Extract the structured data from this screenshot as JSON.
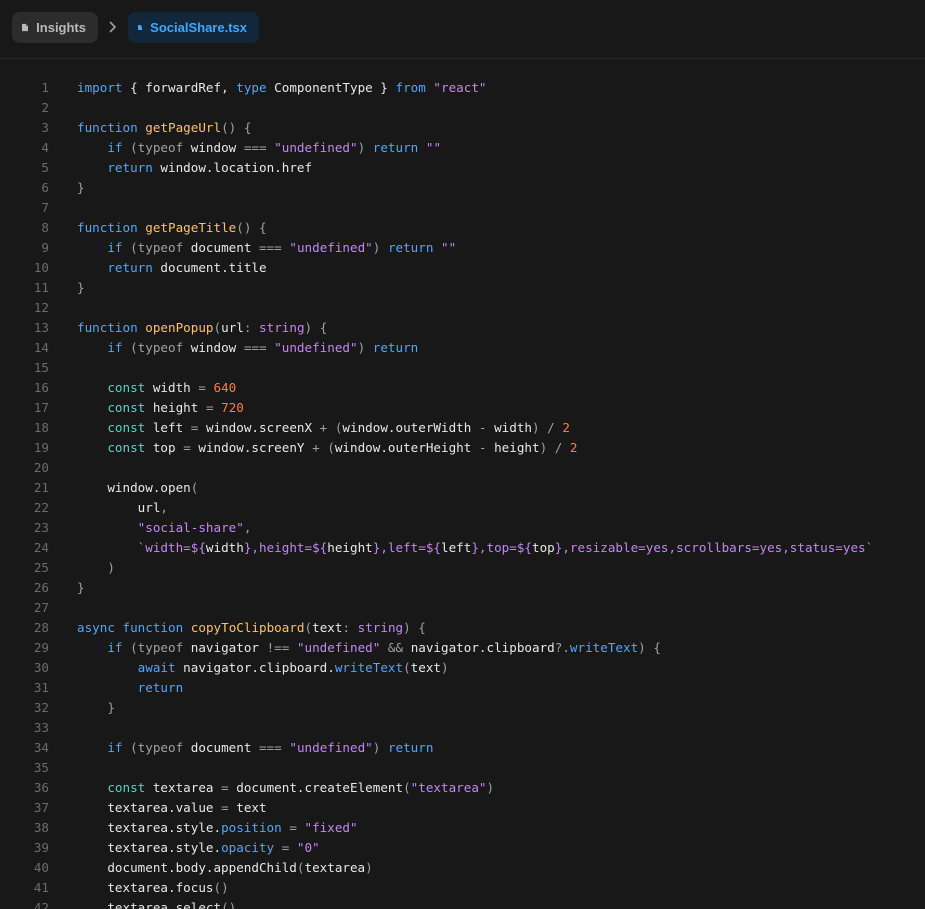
{
  "breadcrumb": {
    "items": [
      {
        "label": "Insights",
        "icon": "file-icon"
      },
      {
        "label": "SocialShare.tsx",
        "icon": "file-icon"
      }
    ]
  },
  "colors": {
    "background": "#181818",
    "keyword": "#4fa6ff",
    "function": "#ffc266",
    "string": "#c585f5",
    "number": "#ff7a45",
    "accent": "#3ea8ff"
  },
  "code": {
    "lines": [
      [
        [
          "kw",
          "import"
        ],
        [
          "p",
          " { forwardRef, "
        ],
        [
          "kw",
          "type"
        ],
        [
          "p",
          " ComponentType } "
        ],
        [
          "kw",
          "from"
        ],
        [
          "p",
          " "
        ],
        [
          "str",
          "\"react\""
        ]
      ],
      [],
      [
        [
          "kw",
          "function"
        ],
        [
          "p",
          " "
        ],
        [
          "fn",
          "getPageUrl"
        ],
        [
          "op",
          "() {"
        ]
      ],
      [
        [
          "p",
          "    "
        ],
        [
          "kw",
          "if"
        ],
        [
          "op",
          " (typeof "
        ],
        [
          "p",
          "window "
        ],
        [
          "op",
          "=== "
        ],
        [
          "str",
          "\"undefined\""
        ],
        [
          "op",
          ") "
        ],
        [
          "kw",
          "return"
        ],
        [
          "p",
          " "
        ],
        [
          "str",
          "\"\""
        ]
      ],
      [
        [
          "p",
          "    "
        ],
        [
          "kw",
          "return"
        ],
        [
          "p",
          " window.location.href"
        ]
      ],
      [
        [
          "op",
          "}"
        ]
      ],
      [],
      [
        [
          "kw",
          "function"
        ],
        [
          "p",
          " "
        ],
        [
          "fn",
          "getPageTitle"
        ],
        [
          "op",
          "() {"
        ]
      ],
      [
        [
          "p",
          "    "
        ],
        [
          "kw",
          "if"
        ],
        [
          "op",
          " (typeof "
        ],
        [
          "p",
          "document "
        ],
        [
          "op",
          "=== "
        ],
        [
          "str",
          "\"undefined\""
        ],
        [
          "op",
          ") "
        ],
        [
          "kw",
          "return"
        ],
        [
          "p",
          " "
        ],
        [
          "str",
          "\"\""
        ]
      ],
      [
        [
          "p",
          "    "
        ],
        [
          "kw",
          "return"
        ],
        [
          "p",
          " document.title"
        ]
      ],
      [
        [
          "op",
          "}"
        ]
      ],
      [],
      [
        [
          "kw",
          "function"
        ],
        [
          "p",
          " "
        ],
        [
          "fn",
          "openPopup"
        ],
        [
          "op",
          "("
        ],
        [
          "p",
          "url"
        ],
        [
          "op",
          ": "
        ],
        [
          "ty",
          "string"
        ],
        [
          "op",
          ") {"
        ]
      ],
      [
        [
          "p",
          "    "
        ],
        [
          "kw",
          "if"
        ],
        [
          "op",
          " (typeof "
        ],
        [
          "p",
          "window "
        ],
        [
          "op",
          "=== "
        ],
        [
          "str",
          "\"undefined\""
        ],
        [
          "op",
          ") "
        ],
        [
          "kw",
          "return"
        ]
      ],
      [],
      [
        [
          "p",
          "    "
        ],
        [
          "tk",
          "const"
        ],
        [
          "p",
          " width "
        ],
        [
          "op",
          "= "
        ],
        [
          "num",
          "640"
        ]
      ],
      [
        [
          "p",
          "    "
        ],
        [
          "tk",
          "const"
        ],
        [
          "p",
          " height "
        ],
        [
          "op",
          "= "
        ],
        [
          "num",
          "720"
        ]
      ],
      [
        [
          "p",
          "    "
        ],
        [
          "tk",
          "const"
        ],
        [
          "p",
          " left "
        ],
        [
          "op",
          "= "
        ],
        [
          "p",
          "window.screenX "
        ],
        [
          "op",
          "+ ("
        ],
        [
          "p",
          "window.outerWidth "
        ],
        [
          "op",
          "- "
        ],
        [
          "p",
          "width"
        ],
        [
          "op",
          ") / "
        ],
        [
          "num",
          "2"
        ]
      ],
      [
        [
          "p",
          "    "
        ],
        [
          "tk",
          "const"
        ],
        [
          "p",
          " top "
        ],
        [
          "op",
          "= "
        ],
        [
          "p",
          "window.screenY "
        ],
        [
          "op",
          "+ ("
        ],
        [
          "p",
          "window.outerHeight "
        ],
        [
          "op",
          "- "
        ],
        [
          "p",
          "height"
        ],
        [
          "op",
          ") / "
        ],
        [
          "num",
          "2"
        ]
      ],
      [],
      [
        [
          "p",
          "    window.open"
        ],
        [
          "op",
          "("
        ]
      ],
      [
        [
          "p",
          "        url"
        ],
        [
          "op",
          ","
        ]
      ],
      [
        [
          "p",
          "        "
        ],
        [
          "str",
          "\"social-share\""
        ],
        [
          "op",
          ","
        ]
      ],
      [
        [
          "p",
          "        "
        ],
        [
          "str",
          "`width=${"
        ],
        [
          "p",
          "width"
        ],
        [
          "str",
          "},height=${"
        ],
        [
          "p",
          "height"
        ],
        [
          "str",
          "},left=${"
        ],
        [
          "p",
          "left"
        ],
        [
          "str",
          "},top=${"
        ],
        [
          "p",
          "top"
        ],
        [
          "str",
          "},resizable=yes,scrollbars=yes,status=yes`"
        ]
      ],
      [
        [
          "op",
          "    )"
        ]
      ],
      [
        [
          "op",
          "}"
        ]
      ],
      [],
      [
        [
          "kw",
          "async"
        ],
        [
          "p",
          " "
        ],
        [
          "kw",
          "function"
        ],
        [
          "p",
          " "
        ],
        [
          "fn",
          "copyToClipboard"
        ],
        [
          "op",
          "("
        ],
        [
          "p",
          "text"
        ],
        [
          "op",
          ": "
        ],
        [
          "ty",
          "string"
        ],
        [
          "op",
          ") {"
        ]
      ],
      [
        [
          "p",
          "    "
        ],
        [
          "kw",
          "if"
        ],
        [
          "op",
          " (typeof "
        ],
        [
          "p",
          "navigator "
        ],
        [
          "op",
          "!== "
        ],
        [
          "str",
          "\"undefined\""
        ],
        [
          "op",
          " && "
        ],
        [
          "p",
          "navigator.clipboard"
        ],
        [
          "op",
          "?."
        ],
        [
          "prop",
          "writeText"
        ],
        [
          "op",
          ") {"
        ]
      ],
      [
        [
          "p",
          "        "
        ],
        [
          "kw",
          "await"
        ],
        [
          "p",
          " navigator.clipboard."
        ],
        [
          "prop",
          "writeText"
        ],
        [
          "op",
          "("
        ],
        [
          "p",
          "text"
        ],
        [
          "op",
          ")"
        ]
      ],
      [
        [
          "p",
          "        "
        ],
        [
          "kw",
          "return"
        ]
      ],
      [
        [
          "op",
          "    }"
        ]
      ],
      [],
      [
        [
          "p",
          "    "
        ],
        [
          "kw",
          "if"
        ],
        [
          "op",
          " (typeof "
        ],
        [
          "p",
          "document "
        ],
        [
          "op",
          "=== "
        ],
        [
          "str",
          "\"undefined\""
        ],
        [
          "op",
          ") "
        ],
        [
          "kw",
          "return"
        ]
      ],
      [],
      [
        [
          "p",
          "    "
        ],
        [
          "tk",
          "const"
        ],
        [
          "p",
          " textarea "
        ],
        [
          "op",
          "= "
        ],
        [
          "p",
          "document.createElement"
        ],
        [
          "op",
          "("
        ],
        [
          "str",
          "\"textarea\""
        ],
        [
          "op",
          ")"
        ]
      ],
      [
        [
          "p",
          "    textarea.value "
        ],
        [
          "op",
          "= "
        ],
        [
          "p",
          "text"
        ]
      ],
      [
        [
          "p",
          "    textarea.style."
        ],
        [
          "prop",
          "position"
        ],
        [
          "op",
          " = "
        ],
        [
          "str",
          "\"fixed\""
        ]
      ],
      [
        [
          "p",
          "    textarea.style."
        ],
        [
          "prop",
          "opacity"
        ],
        [
          "op",
          " = "
        ],
        [
          "str",
          "\"0\""
        ]
      ],
      [
        [
          "p",
          "    document.body.appendChild"
        ],
        [
          "op",
          "("
        ],
        [
          "p",
          "textarea"
        ],
        [
          "op",
          ")"
        ]
      ],
      [
        [
          "p",
          "    textarea.focus"
        ],
        [
          "op",
          "()"
        ]
      ],
      [
        [
          "p",
          "    textarea.select"
        ],
        [
          "op",
          "()"
        ]
      ]
    ]
  }
}
